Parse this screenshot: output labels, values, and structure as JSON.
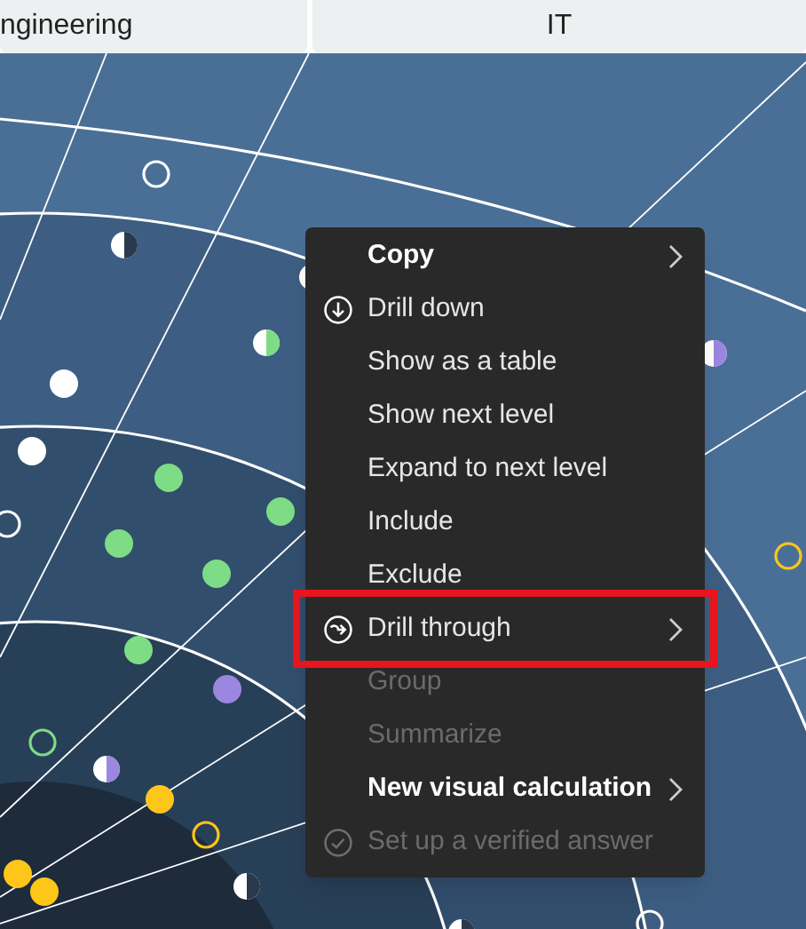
{
  "tabs": [
    {
      "label": "ngineering"
    },
    {
      "label": "IT"
    }
  ],
  "context_menu": {
    "items": [
      {
        "label": "Copy",
        "kind": "plain",
        "submenu": true,
        "disabled": false,
        "bold": true,
        "highlighted": false
      },
      {
        "label": "Drill down",
        "kind": "drilldown",
        "submenu": false,
        "disabled": false,
        "bold": false,
        "highlighted": false
      },
      {
        "label": "Show as a table",
        "kind": "plain",
        "submenu": false,
        "disabled": false,
        "bold": false,
        "highlighted": false
      },
      {
        "label": "Show next level",
        "kind": "plain",
        "submenu": false,
        "disabled": false,
        "bold": false,
        "highlighted": false
      },
      {
        "label": "Expand to next level",
        "kind": "plain",
        "submenu": false,
        "disabled": false,
        "bold": false,
        "highlighted": false
      },
      {
        "label": "Include",
        "kind": "plain",
        "submenu": false,
        "disabled": false,
        "bold": false,
        "highlighted": false
      },
      {
        "label": "Exclude",
        "kind": "plain",
        "submenu": false,
        "disabled": false,
        "bold": false,
        "highlighted": false
      },
      {
        "label": "Drill through",
        "kind": "drillthrough",
        "submenu": true,
        "disabled": false,
        "bold": false,
        "highlighted": true
      },
      {
        "label": "Group",
        "kind": "plain",
        "submenu": false,
        "disabled": true,
        "bold": false,
        "highlighted": false
      },
      {
        "label": "Summarize",
        "kind": "plain",
        "submenu": false,
        "disabled": true,
        "bold": false,
        "highlighted": false
      },
      {
        "label": "New visual calculation",
        "kind": "plain",
        "submenu": true,
        "disabled": false,
        "bold": true,
        "highlighted": false
      },
      {
        "label": "Set up a verified answer",
        "kind": "verify",
        "submenu": false,
        "disabled": true,
        "bold": false,
        "highlighted": false
      }
    ]
  }
}
